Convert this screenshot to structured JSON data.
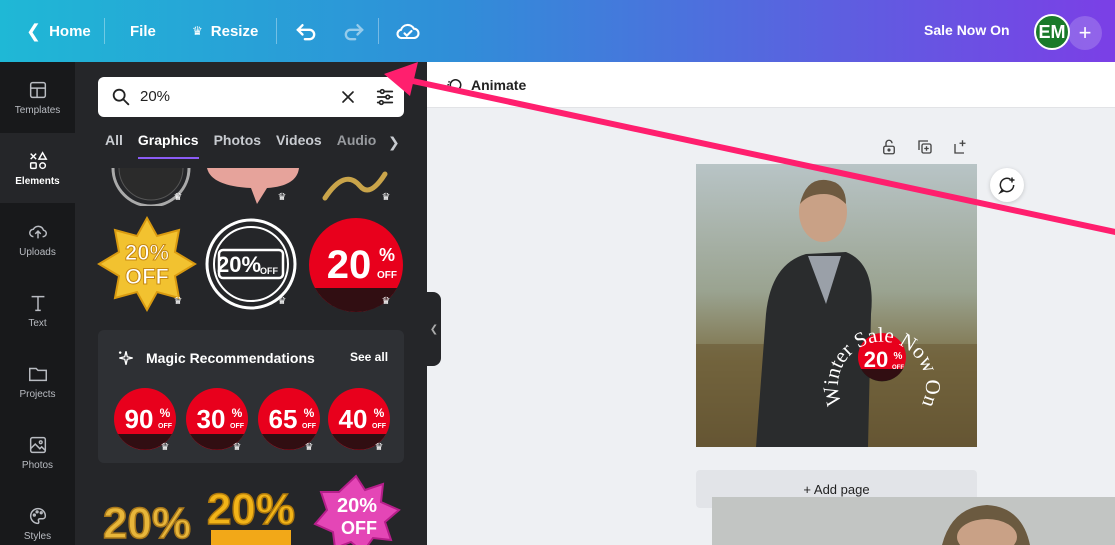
{
  "topbar": {
    "home_label": "Home",
    "file_label": "File",
    "resize_label": "Resize",
    "design_title": "Sale Now On",
    "avatar_initials": "EM",
    "add_label": "+"
  },
  "rail": {
    "items": [
      {
        "label": "Templates",
        "icon": "templates-icon"
      },
      {
        "label": "Elements",
        "icon": "elements-icon"
      },
      {
        "label": "Uploads",
        "icon": "uploads-icon"
      },
      {
        "label": "Text",
        "icon": "text-icon"
      },
      {
        "label": "Projects",
        "icon": "projects-icon"
      },
      {
        "label": "Photos",
        "icon": "photos-icon"
      },
      {
        "label": "Styles",
        "icon": "styles-icon"
      }
    ],
    "active_index": 1
  },
  "panel": {
    "search_value": "20%",
    "tabs": [
      "All",
      "Graphics",
      "Photos",
      "Videos",
      "Audio"
    ],
    "active_tab": "Graphics",
    "graphics_row": [
      {
        "line1": "20%",
        "line2": "OFF"
      },
      {
        "line1": "20%",
        "line2": "OFF"
      },
      {
        "line1": "20",
        "sup": "%",
        "sub": "OFF"
      }
    ],
    "magic": {
      "title": "Magic Recommendations",
      "see_all": "See all",
      "items": [
        {
          "num": "90",
          "sup": "%",
          "sub": "OFF"
        },
        {
          "num": "30",
          "sup": "%",
          "sub": "OFF"
        },
        {
          "num": "65",
          "sup": "%",
          "sub": "OFF"
        },
        {
          "num": "40",
          "sup": "%",
          "sub": "OFF"
        }
      ]
    },
    "bottom_row": [
      {
        "text": "20%"
      },
      {
        "text": "20%"
      },
      {
        "line1": "20%",
        "line2": "OFF"
      }
    ]
  },
  "canvas": {
    "animate_label": "Animate",
    "design_text_circle": "Winter Sale Now On",
    "badge_num": "20",
    "badge_sup": "%",
    "badge_sub": "OFF",
    "add_page_label": "+ Add page"
  },
  "colors": {
    "accent_purple": "#8b5cf6",
    "badge_red": "#e8001c",
    "arrow_pink": "#ff1f6e"
  }
}
